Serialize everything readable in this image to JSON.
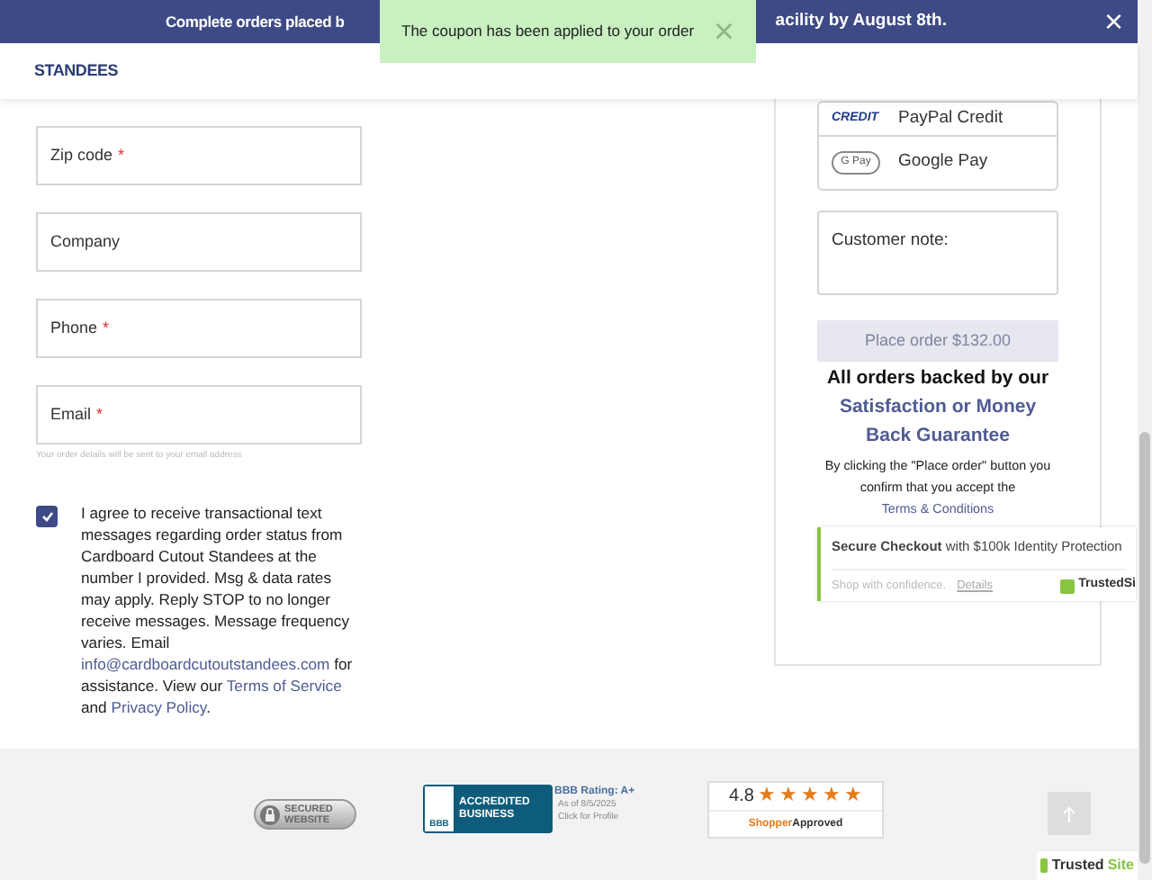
{
  "banner": {
    "text_left": "Complete orders placed b",
    "text_right": "acility by August 8th.",
    "close": "×"
  },
  "toast": {
    "message": "The coupon has been applied to your order",
    "close": "×"
  },
  "logo": {
    "text": "STANDEES"
  },
  "form": {
    "fields": [
      {
        "label": "Zip code",
        "required_mark": "*"
      },
      {
        "label": "Company"
      },
      {
        "label": "Phone",
        "required_mark": "*"
      },
      {
        "label": "Email",
        "required_mark": "*"
      }
    ],
    "email_hint": "Your order details will be sent to your email address",
    "consent": {
      "checked": true,
      "text_before": "I agree to receive transactional text messages regarding order status from Cardboard Cutout Standees at the number I provided. Msg & data rates may apply. Reply STOP to no longer receive messages. Message frequency varies. Email",
      "email_link": "info@cardboardcutoutstandees.com",
      "text_mid": "for assistance. View our",
      "terms_link": "Terms of Service",
      "text_and": "and",
      "privacy_link": "Privacy Policy",
      "text_end": "."
    }
  },
  "payment_methods": [
    {
      "kind": "paypal-credit",
      "label": "PayPal Credit",
      "logo": "CREDIT"
    },
    {
      "kind": "google-pay",
      "label": "Google Pay",
      "logo": "G Pay"
    }
  ],
  "customer_note": {
    "placeholder": "Customer note:"
  },
  "place_order": {
    "label": "Place order  $132.00",
    "disabled": true
  },
  "guarantee": {
    "line1": "All orders backed by our",
    "line2": "Satisfaction or Money Back Guarantee"
  },
  "terms_notice": {
    "text": "By clicking the \"Place order\" button you confirm that you accept the",
    "link": "Terms & Conditions"
  },
  "trusted_box": {
    "title": "Secure Checkout",
    "title_rest": "with $100k Identity Protection",
    "subtitle": "Shop with confidence.",
    "details": "Details",
    "badge": "TrustedSi"
  },
  "footer": {
    "secured": [
      "SECURED",
      "WEBSITE"
    ],
    "bbb": {
      "accredited": "ACCREDITED",
      "business": "BUSINESS",
      "logo": "BBB",
      "rating": "BBB Rating: A+",
      "as_of": "As of 8/5/2025",
      "click": "Click for Profile"
    },
    "shopper": {
      "score": "4.8",
      "stars": 5,
      "brand_a": "Shopper",
      "brand_b": "Approved"
    },
    "trustedsite": {
      "a": "Trusted",
      "b": "Site"
    }
  }
}
